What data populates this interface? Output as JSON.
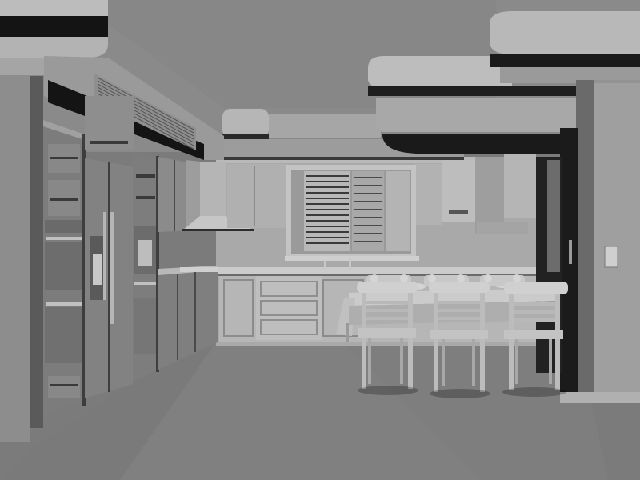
{
  "scene": {
    "subject": "kitchen-interior-clay-render",
    "palette": {
      "background": "#7b7b7b",
      "ceiling": "#8a8a8a",
      "floor": "#808080",
      "back_wall": "#a9a9a9",
      "cabinet_light": "#b3b3b3",
      "cabinet_mid": "#9d9d9d",
      "cabinet_dark": "#6e6e6e",
      "shadow": "#151515",
      "highlight": "#c9c9c9"
    }
  }
}
